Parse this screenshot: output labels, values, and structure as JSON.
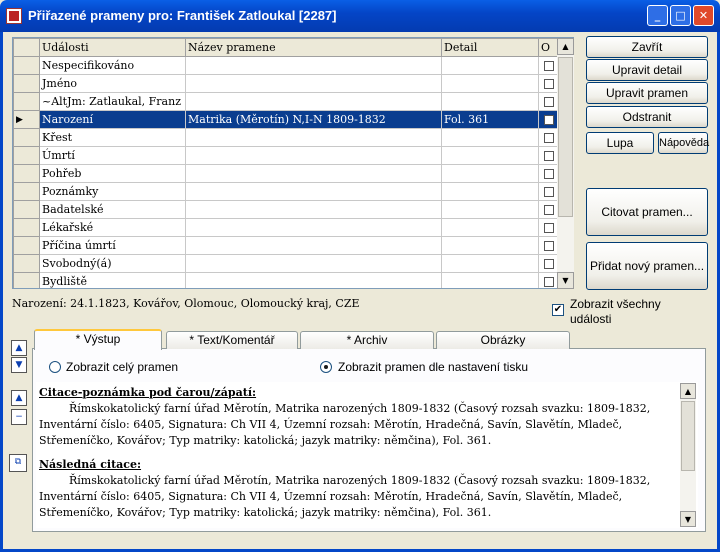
{
  "window": {
    "title": "Přiřazené prameny pro: František Zatloukal [2287]",
    "min_glyph": "_",
    "max_glyph": "□",
    "close_glyph": "✕"
  },
  "grid": {
    "headers": [
      "Události",
      "Název pramene",
      "Detail",
      "O"
    ],
    "current_marker": "▶",
    "rows": [
      {
        "event": "Nespecifikováno",
        "source": "",
        "detail": ""
      },
      {
        "event": "Jméno",
        "source": "",
        "detail": ""
      },
      {
        "event": "~AltJm: Zatlaukal, Franz",
        "source": "",
        "detail": ""
      },
      {
        "event": "Narození",
        "source": "Matrika (Měrotín) N,I-N 1809-1832",
        "detail": "Fol. 361"
      },
      {
        "event": "Křest",
        "source": "",
        "detail": ""
      },
      {
        "event": "Úmrtí",
        "source": "",
        "detail": ""
      },
      {
        "event": "Pohřeb",
        "source": "",
        "detail": ""
      },
      {
        "event": "Poznámky",
        "source": "",
        "detail": ""
      },
      {
        "event": "Badatelské",
        "source": "",
        "detail": ""
      },
      {
        "event": "Lékařské",
        "source": "",
        "detail": ""
      },
      {
        "event": "Příčina úmrtí",
        "source": "",
        "detail": ""
      },
      {
        "event": "Svobodný(á)",
        "source": "",
        "detail": ""
      },
      {
        "event": "Bydliště",
        "source": "",
        "detail": ""
      }
    ],
    "selected_row": 3
  },
  "buttons": {
    "close": "Zavřít",
    "edit_detail": "Upravit detail",
    "edit_source": "Upravit pramen",
    "remove": "Odstranit",
    "magnifier": "Lupa",
    "help": "Nápověda",
    "cite_source": "Citovat pramen...",
    "add_source": "Přidat nový pramen..."
  },
  "status_line": "Narození: 24.1.1823, Kovářov, Olomouc, Olomoucký kraj, CZE",
  "show_all_events": {
    "label_line1": "Zobrazit všechny",
    "label_line2": "události",
    "checked": true
  },
  "tabs": [
    "* Výstup",
    "* Text/Komentář",
    "* Archiv",
    "Obrázky"
  ],
  "active_tab": 0,
  "output": {
    "radio_full": "Zobrazit celý pramen",
    "radio_print": "Zobrazit pramen dle nastavení tisku",
    "selected": "print",
    "footnote_heading": "Citace-poznámka pod čarou/zápatí:",
    "footnote_text": "Římskokatolický farní úřad Měrotín, Matrika narozených 1809-1832 (Časový rozsah svazku: 1809-1832, Inventární číslo: 6405, Signatura: Ch VII 4, Územní rozsah: Měrotín, Hradečná, Savín, Slavětín, Mladeč, Střemeníčko, Kovářov; Typ matriky: katolická; jazyk matriky: němčina), Fol. 361.",
    "subsequent_heading": "Následná citace:",
    "subsequent_text": "Římskokatolický farní úřad Měrotín, Matrika narozených 1809-1832 (Časový rozsah svazku: 1809-1832, Inventární číslo: 6405, Signatura: Ch VII 4, Územní rozsah: Měrotín, Hradečná, Savín, Slavětín, Mladeč, Střemeníčko, Kovářov; Typ matriky: katolická; jazyk matriky: němčina), Fol. 361."
  },
  "icons": {
    "app": "family-tree-app-icon",
    "side": [
      "move-up-icon",
      "move-down-icon",
      "collapse-up-icon",
      "minus-icon",
      "copy-icon"
    ]
  },
  "glyphs": {
    "up": "▲",
    "down": "▼",
    "minus": "−",
    "copy": "⧉",
    "check": "✔"
  }
}
